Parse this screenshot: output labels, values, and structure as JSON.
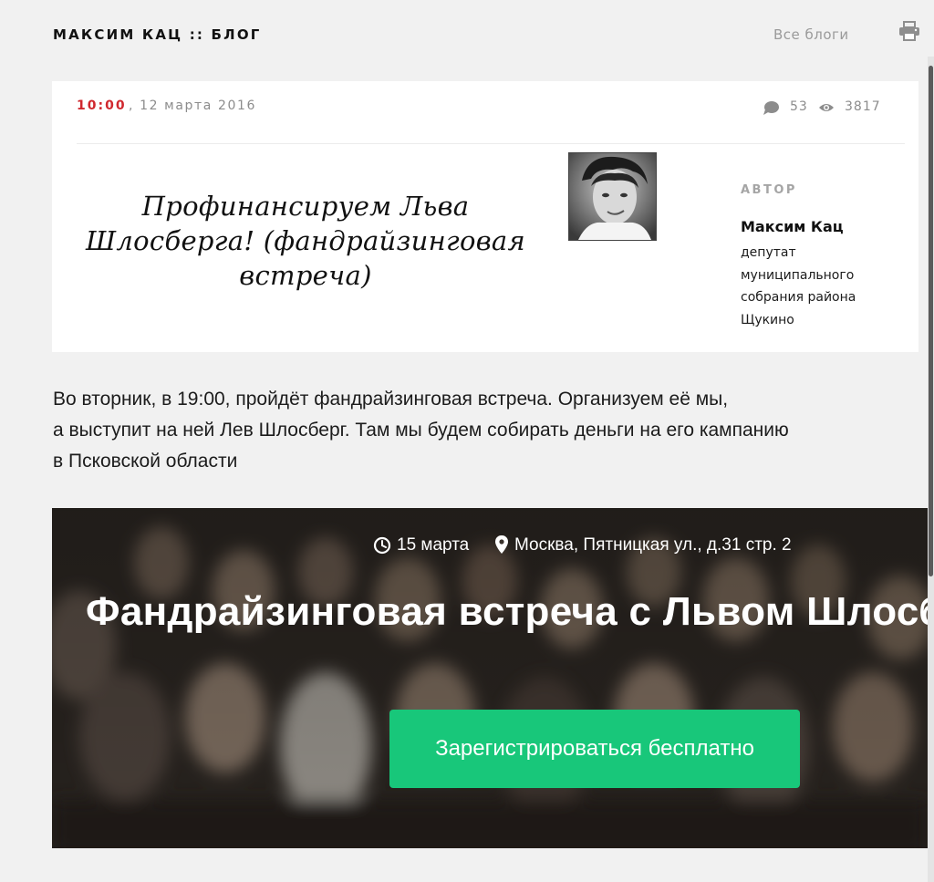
{
  "header": {
    "blog_title": "МАКСИМ КАЦ :: БЛОГ",
    "all_blogs_link": "Все блоги",
    "print_icon": "printer-icon"
  },
  "post": {
    "time": "10:00",
    "date": ", 12 марта 2016",
    "comments_count": "53",
    "views_count": "3817",
    "comment_icon": "speech-bubble-icon",
    "views_icon": "eye-icon",
    "title": "Профинансируем Льва Шлосберга! (фандрайзинговая встреча)",
    "author": {
      "heading": "АВТОР",
      "name": "Максим Кац",
      "role": "депутат муниципального собрания района Щукино"
    },
    "intro_lines": [
      "Во вторник, в 19:00, пройдёт фандрайзинговая встреча. Организуем её мы,",
      "а выступит на ней Лев Шлосберг. Там мы будем собирать деньги на его кампанию",
      "в Псковской области"
    ]
  },
  "banner": {
    "date": "15 марта",
    "place": "Москва, Пятницкая ул., д.31 стр. 2",
    "headline": "Фандрайзинговая встреча с Львом Шлосбергом",
    "register_button": "Зарегистрироваться бесплатно",
    "clock_icon": "clock-icon",
    "pin_icon": "map-pin-icon",
    "accent_color": "#18c77a"
  },
  "colors": {
    "time_red": "#d0282e",
    "background": "#f1f1f1",
    "card": "#ffffff"
  }
}
